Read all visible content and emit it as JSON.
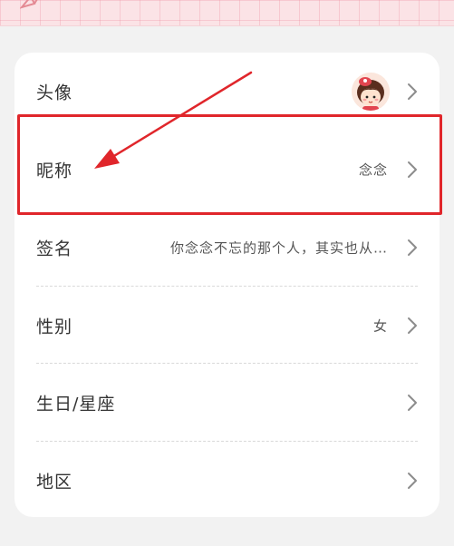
{
  "profile": {
    "rows": [
      {
        "label": "头像",
        "value": ""
      },
      {
        "label": "昵称",
        "value": "念念"
      },
      {
        "label": "签名",
        "value": "你念念不忘的那个人，其实也从…"
      },
      {
        "label": "性别",
        "value": "女"
      },
      {
        "label": "生日/星座",
        "value": ""
      },
      {
        "label": "地区",
        "value": ""
      }
    ]
  },
  "annotation": {
    "color": "#e0262b"
  },
  "icons": {
    "chevron": "chevron-right-icon",
    "avatar": "cartoon-girl-avatar"
  }
}
